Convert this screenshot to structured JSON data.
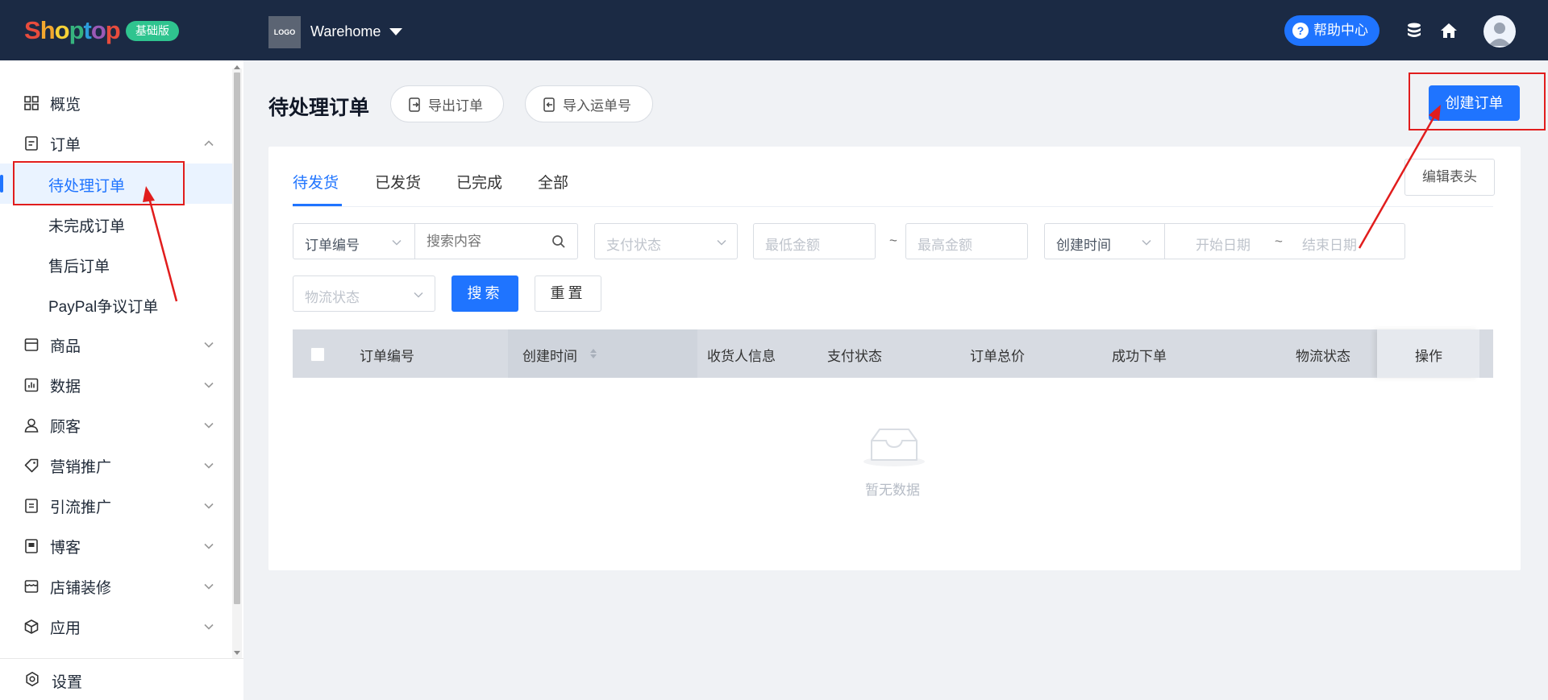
{
  "brand": {
    "letters": [
      "S",
      "h",
      "o",
      "p",
      "t",
      "o",
      "p"
    ],
    "letter_colors": [
      "#e84c3d",
      "#f2a72e",
      "#f6d137",
      "#36b37e",
      "#2d9cdb",
      "#9b59b6",
      "#e84c3d"
    ],
    "plan_badge": "基础版",
    "badge_color": "#2fc48f"
  },
  "store": {
    "logo_text": "LOGO",
    "name": "Warehome",
    "caret_icon": "caret-down-icon"
  },
  "topbar": {
    "help_label": "帮助中心",
    "icons": [
      "question-icon",
      "database-icon",
      "home-icon",
      "user-avatar"
    ],
    "background": "#1b2a44"
  },
  "sidebar": {
    "items": [
      {
        "label": "概览",
        "icon": "dashboard-icon",
        "has_children": false
      },
      {
        "label": "订单",
        "icon": "order-icon",
        "has_children": true,
        "expanded": true,
        "children": [
          {
            "label": "待处理订单",
            "active": true
          },
          {
            "label": "未完成订单",
            "active": false
          },
          {
            "label": "售后订单",
            "active": false
          },
          {
            "label": "PayPal争议订单",
            "active": false
          }
        ]
      },
      {
        "label": "商品",
        "icon": "product-icon",
        "has_children": true
      },
      {
        "label": "数据",
        "icon": "chart-icon",
        "has_children": true
      },
      {
        "label": "顾客",
        "icon": "customer-icon",
        "has_children": true
      },
      {
        "label": "营销推广",
        "icon": "tag-icon",
        "has_children": true
      },
      {
        "label": "引流推广",
        "icon": "traffic-icon",
        "has_children": true
      },
      {
        "label": "博客",
        "icon": "blog-icon",
        "has_children": true
      },
      {
        "label": "店铺装修",
        "icon": "store-decor-icon",
        "has_children": true
      },
      {
        "label": "应用",
        "icon": "app-cube-icon",
        "has_children": true
      }
    ],
    "settings_label": "设置",
    "settings_icon": "gear-icon"
  },
  "header": {
    "title": "待处理订单",
    "export_label": "导出订单",
    "import_label": "导入运单号",
    "create_label": "创建订单",
    "accent": "#1f74ff"
  },
  "tabs": [
    {
      "label": "待发货",
      "active": true
    },
    {
      "label": "已发货",
      "active": false
    },
    {
      "label": "已完成",
      "active": false
    },
    {
      "label": "全部",
      "active": false
    }
  ],
  "edit_columns_label": "编辑表头",
  "filters": {
    "order_field_select": "订单编号",
    "search_placeholder": "搜索内容",
    "payment_status_placeholder": "支付状态",
    "min_amount_placeholder": "最低金额",
    "range_sep": "~",
    "max_amount_placeholder": "最高金额",
    "time_field_select": "创建时间",
    "start_date_placeholder": "开始日期",
    "end_date_placeholder": "结束日期",
    "logistics_placeholder": "物流状态",
    "search_label": "搜索",
    "reset_label": "重置"
  },
  "table": {
    "columns": [
      "订单编号",
      "创建时间",
      "收货人信息",
      "支付状态",
      "订单总价",
      "成功下单",
      "物流状态",
      "操作"
    ],
    "rows": [],
    "empty_text": "暂无数据"
  },
  "annotations": {
    "highlight_color": "#e11d1d"
  }
}
